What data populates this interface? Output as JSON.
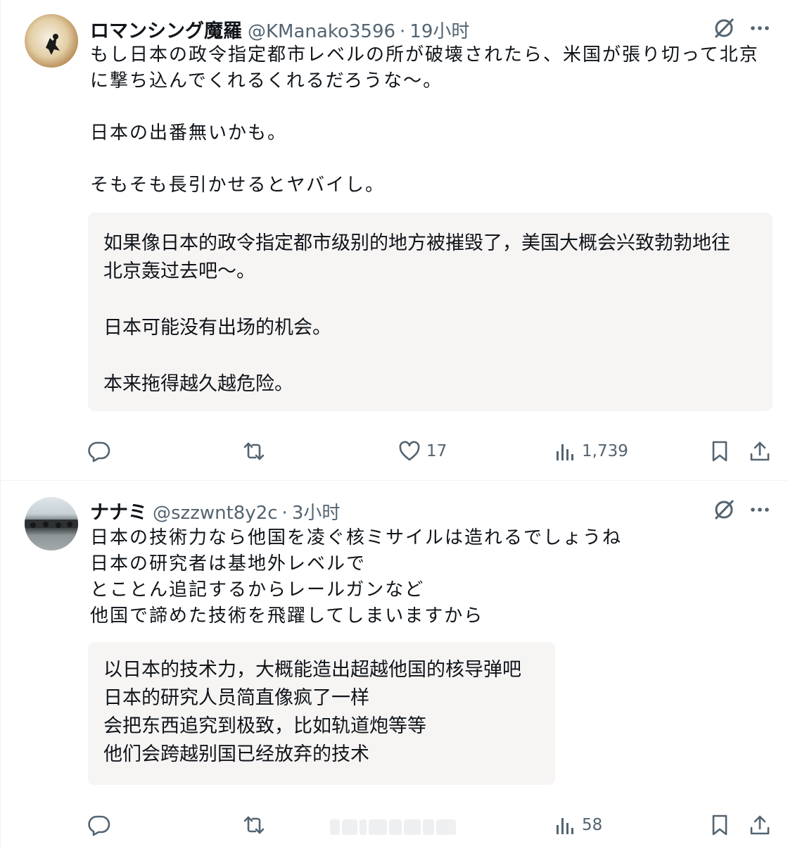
{
  "posts": [
    {
      "author": "ロマンシング魔羅",
      "handle": "@KManako3596",
      "separator": "·",
      "time": "19小时",
      "text_lines": [
        "もし日本の政令指定都市レベルの所が破壊されたら、米国が張り切って北京",
        "に撃ち込んでくれるくれるだろうな〜。",
        "",
        "日本の出番無いかも。",
        "",
        "そもそも長引かせるとヤバイし。"
      ],
      "translation_lines": [
        "如果像日本的政令指定都市级别的地方被摧毁了，美国大概会兴致勃勃地往",
        "北京轰过去吧〜。",
        "",
        "日本可能没有出场的机会。",
        "",
        "本来拖得越久越危险。"
      ],
      "like_count": "17",
      "view_count": "1,739"
    },
    {
      "author": "ナナミ",
      "handle": "@szzwnt8y2c",
      "separator": "·",
      "time": "3小时",
      "text_lines": [
        "日本の技術力なら他国を凌ぐ核ミサイルは造れるでしょうね",
        "日本の研究者は基地外レベルで",
        "とことん追記するからレールガンなど",
        "他国で諦めた技術を飛躍してしまいますから"
      ],
      "translation_lines": [
        "以日本的技术力，大概能造出超越他国的核导弹吧",
        "日本的研究人员简直像疯了一样",
        "会把东西追究到极致，比如轨道炮等等",
        "他们会跨越别国已经放弃的技术"
      ],
      "like_count": "",
      "view_count": "58"
    }
  ],
  "icons": {
    "grok": "grok-icon",
    "more": "more-icon",
    "reply": "reply-icon",
    "retweet": "retweet-icon",
    "like": "heart-icon",
    "views": "views-icon",
    "bookmark": "bookmark-icon",
    "share": "share-icon"
  },
  "colors": {
    "text": "#0f1419",
    "secondary": "#536471",
    "translation_bg": "#f7f4f4",
    "divider": "#eff3f4"
  }
}
